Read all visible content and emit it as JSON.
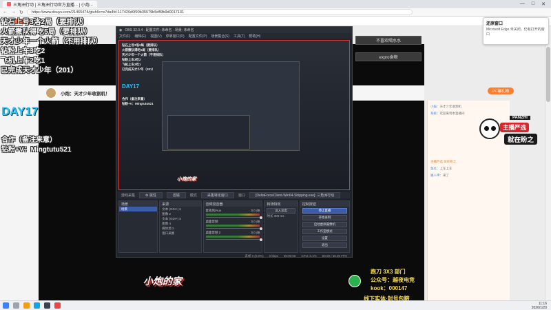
{
  "browser": {
    "tab_title": "三角洲行动 | 三角洲行动官方直播... | 小炮...",
    "url": "https://www.douyu.com/21465474/gtuhl/c=e7da4fd-117426d0f90b35579b5df6fb9d0017131",
    "window_controls": [
      "—",
      "□",
      "✕"
    ],
    "nav_icons": [
      "←",
      "→",
      "↻"
    ]
  },
  "overlay_left": {
    "lines": [
      "钻石上号3洛2局（要排队）",
      "火箭撒队得吃5局（要排队）",
      "天才少年一个火箭（不用排队）",
      "钻粉上车3吃2",
      "飞机上车2吃1",
      "已完成天才少年（201）"
    ],
    "day": "DAY17",
    "coop_line1": "合作（备注来意）",
    "coop_line2": "钻粉+V：Mingtutu521"
  },
  "streamer": {
    "name": "小炮：天才少年收割机！"
  },
  "obs": {
    "title": "OBS 32.0.4 - 配置文件: 未命名 - 场景: 未命名",
    "menu": [
      "文件(F)",
      "编辑(E)",
      "视图(V)",
      "停靠窗口(D)",
      "配置文件(P)",
      "场景集合(S)",
      "工具(T)",
      "帮助(H)"
    ],
    "preview_logo": "小炮的家",
    "preview_day": "DAY17",
    "toolbar": {
      "source_label": "游戏采集",
      "props_btn": "⚙ 属性",
      "filter_btn": "滤镜",
      "mode_label": "模式",
      "mode_value": "采集特定窗口",
      "window_label": "窗口",
      "window_value": "[DeltaForceClient-Win64-Shipping.exe]: 三角洲行动"
    },
    "docks": {
      "scenes": {
        "title": "场景",
        "items": [
          "场景"
        ]
      },
      "sources": {
        "title": "来源",
        "items": [
          "文本 (GDI+) 6",
          "图像 2",
          "文本 (GDI+) 5",
          "图像 4",
          "媒体源 2",
          "窗口采集"
        ]
      },
      "mixer": {
        "title": "音频混音器",
        "rows": [
          {
            "name": "麦克风/Aux",
            "level": "0.0 dB"
          },
          {
            "name": "桌面音频",
            "level": "0.0 dB"
          },
          {
            "name": "桌面音频 2",
            "level": "0.0 dB"
          }
        ]
      },
      "transitions": {
        "title": "转场特效",
        "type": "淡入淡出",
        "duration_label": "时长",
        "duration": "300 ms"
      },
      "controls": {
        "title": "控制按钮",
        "buttons": [
          "停止直播",
          "开始录制",
          "启动虚拟摄像机",
          "工作室模式",
          "设置",
          "退出"
        ]
      }
    },
    "status": [
      "丢帧 0 (0.0%)",
      "0 kbps",
      "00:00:00",
      "CPU: 0.4%",
      "60.00 / 60.00 FPS"
    ]
  },
  "right_panel": {
    "btn1": "不喜欢喝水水",
    "btn2": "expro食物",
    "gift_btn": "PC端礼物",
    "panda_tag": "PANZHI",
    "panda_badge1": "主播严选",
    "panda_badge2": "就在盼之",
    "chat": [
      {
        "name": "小猫",
        "text": "：天才少年收割机"
      },
      {
        "name": "系统",
        "text": "：欢迎来到本直播间"
      },
      {
        "name": "鱼丸",
        "text": "：上车上车"
      },
      {
        "name": "路人甲",
        "text": "：来了"
      }
    ],
    "chat_notice": "主播严选 就在盼之"
  },
  "notification": {
    "title": "还原窗口",
    "body": "Microsoft Edge 未关闭，仍有打开的窗口"
  },
  "bottom_overlay": {
    "logo": "小炮的家",
    "line1": "跑刀 3X3 部门",
    "line2": "公众号：越夜电竞",
    "line3": "kook：000147",
    "line4": "线下实体·封号包赔"
  },
  "taskbar": {
    "time": "11:16",
    "date": "2026/1/20"
  },
  "colors": {
    "day_accent": "#1ec8ff",
    "obs_bg": "#1f232b",
    "live_red": "#d9262a",
    "gift_orange": "#ff7d2e",
    "wechat_green": "#2bb24c"
  }
}
